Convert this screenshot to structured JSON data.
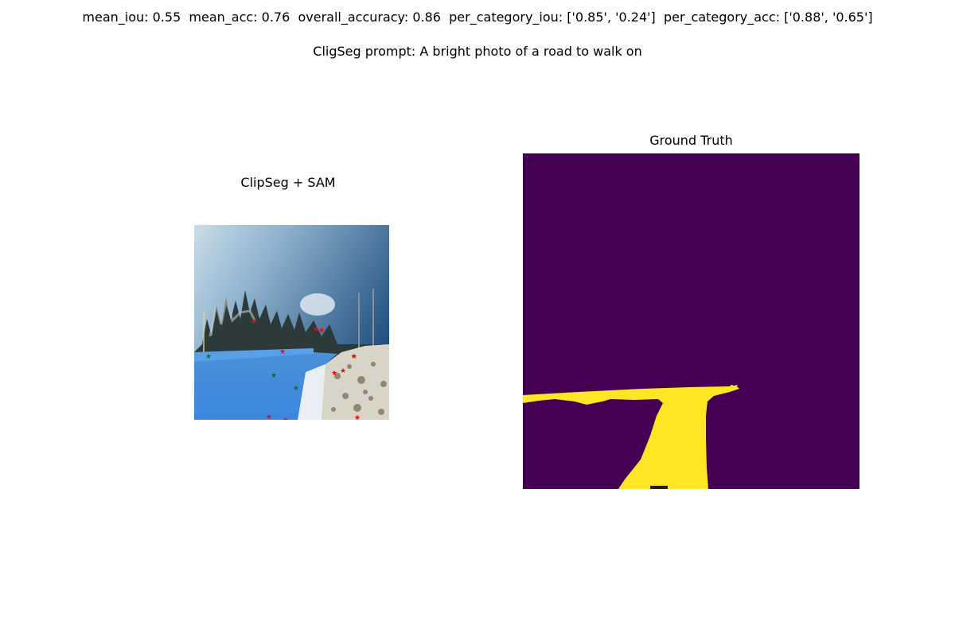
{
  "header": {
    "metrics_line": "mean_iou: 0.55  mean_acc: 0.76  overall_accuracy: 0.86  per_category_iou: ['0.85', '0.24']  per_category_acc: ['0.88', '0.65']",
    "prompt_line": "CligSeg prompt: A bright photo of a road to walk on"
  },
  "left_panel": {
    "title": "ClipSeg + SAM",
    "image_description_icon": "winter-road-photo",
    "positive_point_color": "#008000",
    "negative_point_color": "#ff0000",
    "mask_overlay_color": "#1e90ff"
  },
  "right_panel": {
    "title": "Ground Truth",
    "background_color": "#440154",
    "foreground_color": "#fde725"
  }
}
